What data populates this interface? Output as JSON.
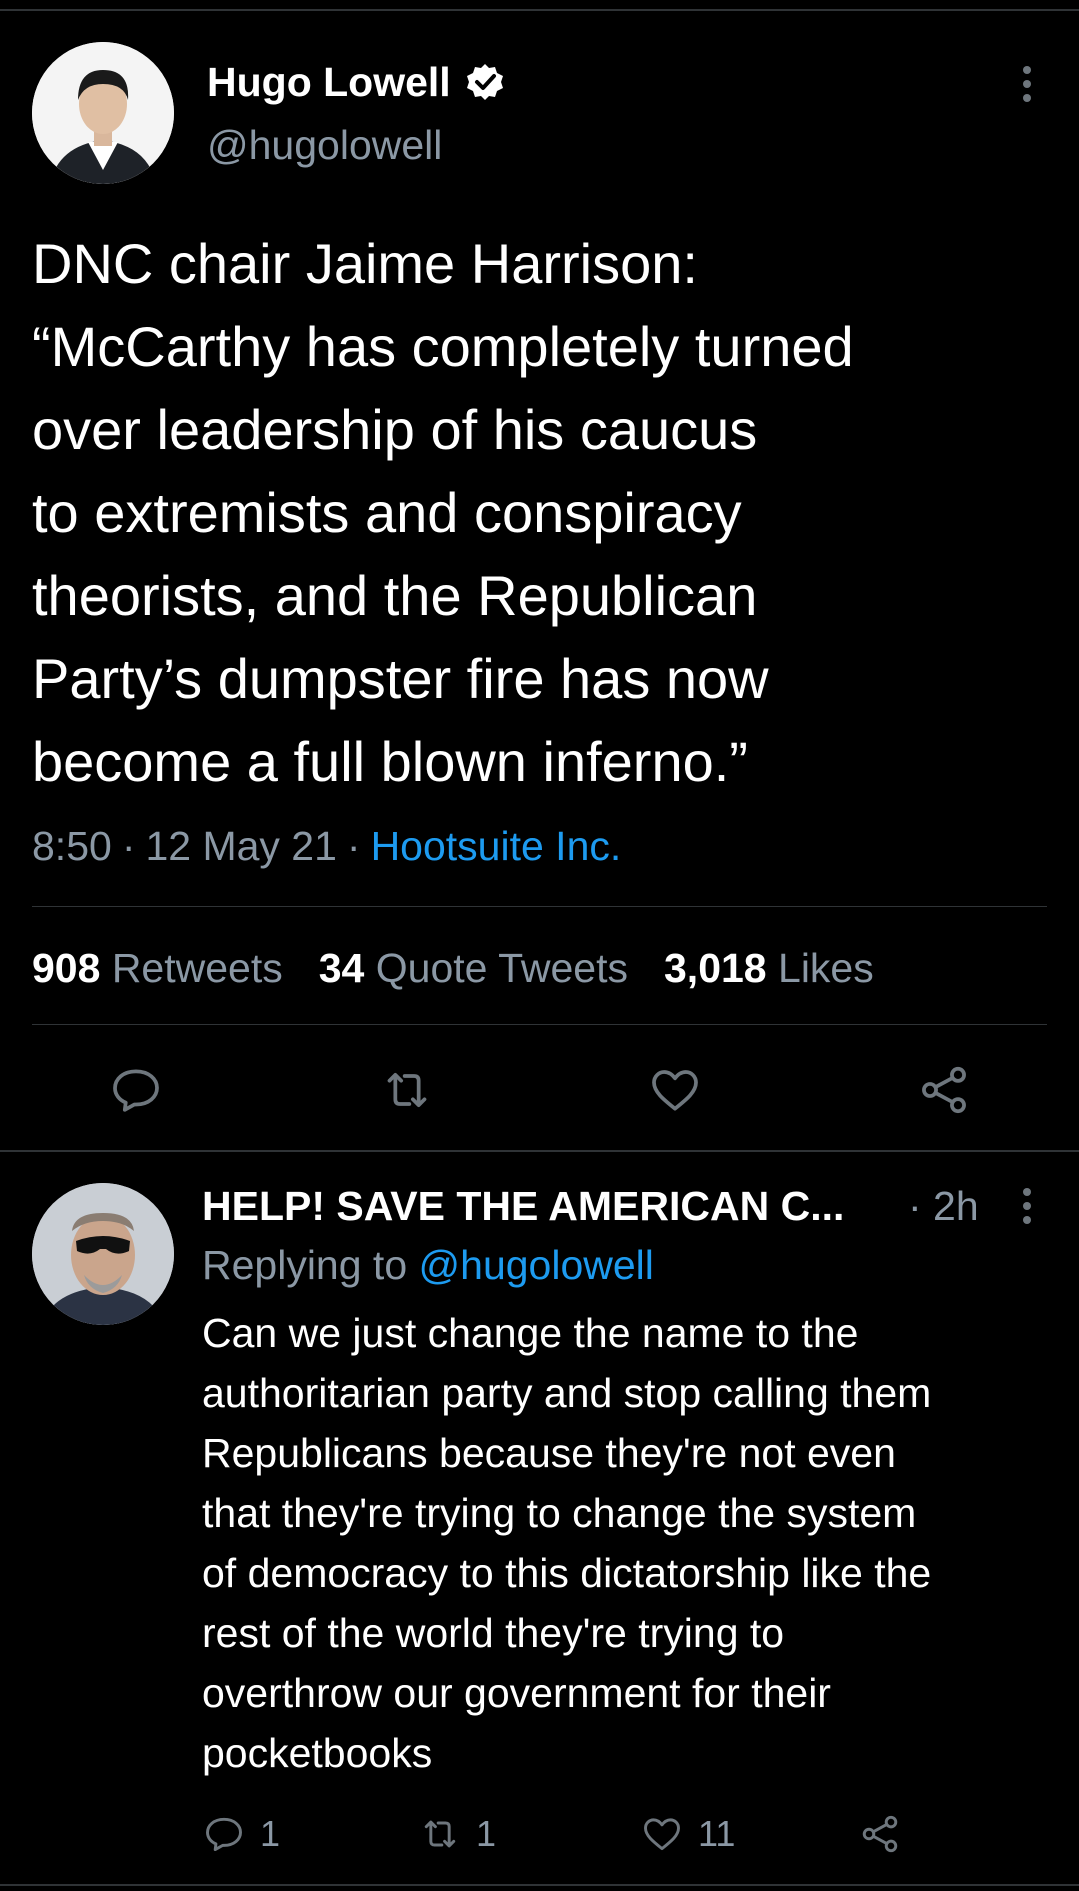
{
  "tweet": {
    "author_name": "Hugo Lowell",
    "author_handle": "@hugolowell",
    "text_lines": [
      "DNC chair Jaime Harrison:",
      "“McCarthy has completely turned",
      "over leadership of his caucus",
      "to extremists and conspiracy",
      "theorists, and the Republican",
      "Party’s dumpster fire has now",
      "become a full blown inferno.”"
    ],
    "time": "8:50",
    "date": "12 May 21",
    "separator": "·",
    "source": "Hootsuite Inc.",
    "stats": {
      "retweets_count": "908",
      "retweets_label": "Retweets",
      "quotes_count": "34",
      "quotes_label": "Quote Tweets",
      "likes_count": "3,018",
      "likes_label": "Likes"
    },
    "actions": [
      "reply-icon",
      "retweet-icon",
      "like-icon",
      "share-icon"
    ]
  },
  "reply": {
    "author_name": "HELP! SAVE THE AMERICAN C...",
    "time": "· 2h",
    "replying_prefix": "Replying to",
    "replying_handle": "@hugolowell",
    "text_lines": [
      "Can we just change the name to the",
      "authoritarian party and stop calling them",
      "Republicans because they're not even",
      "that they're trying to change the system",
      "of democracy to this dictatorship like the",
      "rest of the world they're trying to",
      "overthrow our government for their",
      "pocketbooks"
    ],
    "reply_count": "1",
    "retweet_count": "1",
    "like_count": "11"
  },
  "colors": {
    "background": "#000000",
    "text": "#ffffff",
    "secondary_text": "#8b98a5",
    "link": "#1d9bf0",
    "divider": "#2f3336",
    "icon": "#6e767d"
  }
}
